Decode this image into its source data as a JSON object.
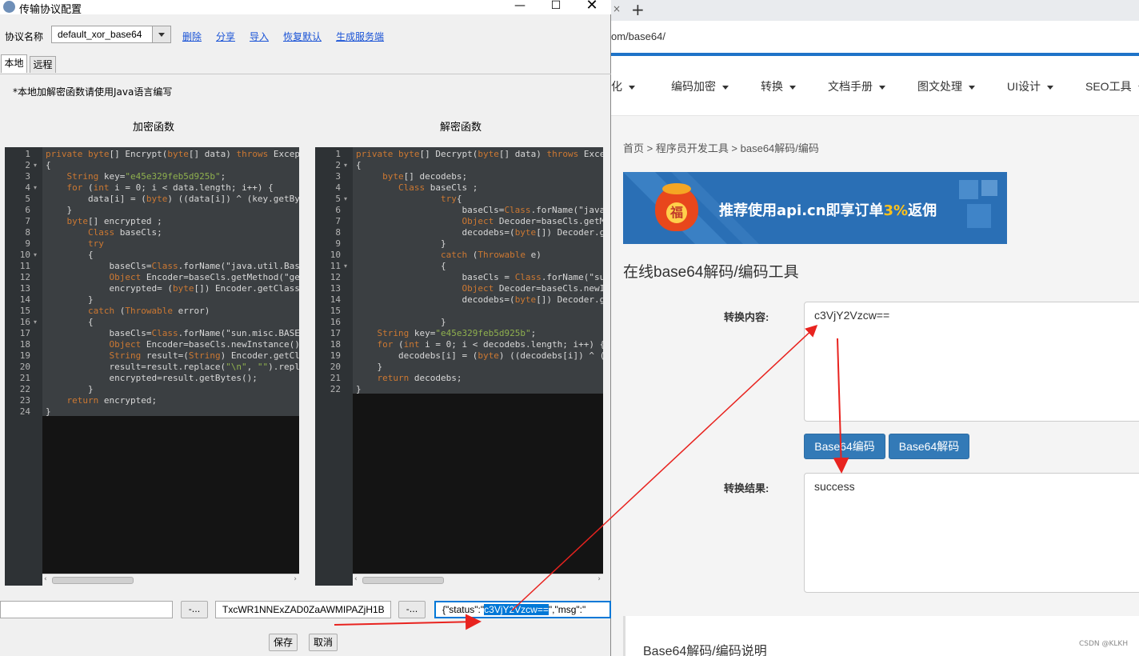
{
  "dialog": {
    "title": "传输协议配置",
    "protocol_label": "协议名称",
    "protocol_value": "default_xor_base64",
    "links": [
      "删除",
      "分享",
      "导入",
      "恢复默认",
      "生成服务端"
    ],
    "tabs": [
      "本地",
      "远程"
    ],
    "note": "*本地加解密函数请使用Java语言编写",
    "encrypt_title": "加密函数",
    "decrypt_title": "解密函数",
    "encrypt_code": [
      "private byte[] Encrypt(byte[] data) throws Excep",
      "{",
      "    String key=\"e45e329feb5d925b\";",
      "    for (int i = 0; i < data.length; i++) {",
      "        data[i] = (byte) ((data[i]) ^ (key.getBy",
      "    }",
      "    byte[] encrypted ;",
      "        Class baseCls;",
      "        try",
      "        {",
      "            baseCls=Class.forName(\"java.util.Bas",
      "            Object Encoder=baseCls.getMethod(\"ge",
      "            encrypted= (byte[]) Encoder.getClass",
      "        }",
      "        catch (Throwable error)",
      "        {",
      "            baseCls=Class.forName(\"sun.misc.BASE",
      "            Object Encoder=baseCls.newInstance()",
      "            String result=(String) Encoder.getCl",
      "            result=result.replace(\"\\n\", \"\").repl",
      "            encrypted=result.getBytes();",
      "        }",
      "    return encrypted;",
      "}"
    ],
    "decrypt_code": [
      "private byte[] Decrypt(byte[] data) throws Exce",
      "{",
      "     byte[] decodebs;",
      "        Class baseCls ;",
      "                try{",
      "                    baseCls=Class.forName(\"java",
      "                    Object Decoder=baseCls.getM",
      "                    decodebs=(byte[]) Decoder.g",
      "                }",
      "                catch (Throwable e)",
      "                {",
      "                    baseCls = Class.forName(\"su",
      "                    Object Decoder=baseCls.newI",
      "                    decodebs=(byte[]) Decoder.g",
      "",
      "                }",
      "    String key=\"e45e329feb5d925b\";",
      "    for (int i = 0; i < decodebs.length; i++) {",
      "        decodebs[i] = (byte) ((decodebs[i]) ^ (",
      "    }",
      "    return decodebs;",
      "}"
    ],
    "input_field_value": "",
    "browse_label": "-...",
    "encoded_field_value": "TxcWR1NNExZAD0ZaAWMIPAZjH1B",
    "result_prefix": "{\"status\":\"",
    "result_selected": "c3VjY2Vzcw==",
    "result_suffix": "\",\"msg\":\"",
    "save_label": "保存",
    "cancel_label": "取消"
  },
  "browser": {
    "url": "om/base64/",
    "nav": [
      "化",
      "编码加密",
      "转换",
      "文档手册",
      "图文处理",
      "UI设计",
      "SEO工具"
    ],
    "breadcrumb": "首页 > 程序员开发工具 > base64解码/编码",
    "banner_text_main": "推荐使用api.cn即享订单",
    "banner_text_accent": "3%",
    "banner_text_tail": "返佣",
    "banner_badge": "福",
    "tool_title": "在线base64解码/编码工具",
    "input_label": "转换内容:",
    "input_value": "c3VjY2Vzcw==",
    "encode_button": "Base64编码",
    "decode_button": "Base64解码",
    "result_label": "转换结果:",
    "result_value": "success",
    "desc_title": "Base64解码/编码说明",
    "watermark": "CSDN @KLKH"
  },
  "colors": {
    "accent_blue": "#337ab7",
    "annotation_red": "#e8231f",
    "selection_blue": "#0078d7"
  }
}
